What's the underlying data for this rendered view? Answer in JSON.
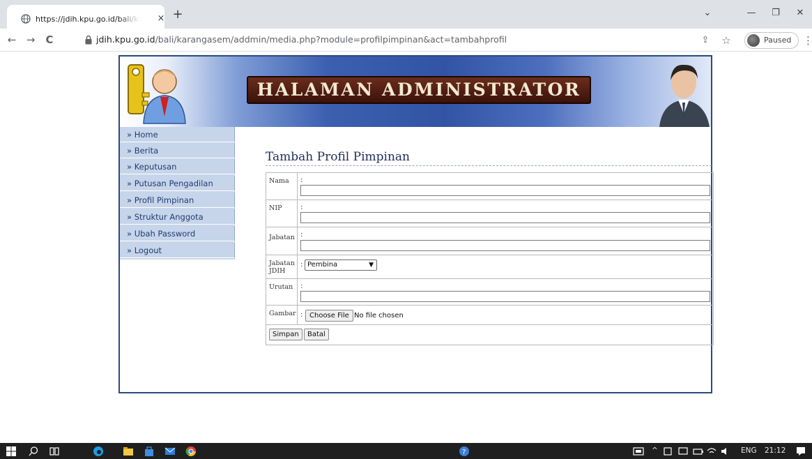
{
  "browser": {
    "tab": {
      "title": "https://jdih.kpu.go.id/bali/karangasem/addmin/media.php",
      "close_glyph": "×",
      "favicon": "globe-icon"
    },
    "new_tab_glyph": "+",
    "window_controls": {
      "tab_search": "⌄",
      "minimize": "—",
      "restore": "❐",
      "close": "✕"
    },
    "nav": {
      "back": "←",
      "forward": "→",
      "reload": "C"
    },
    "address": {
      "host": "jdih.kpu.go.id",
      "path": "/bali/karangasem/addmin/media.php?module=profilpimpinan&act=tambahprofil"
    },
    "share_glyph": "⇪",
    "star_glyph": "☆",
    "profile_label": "Paused",
    "menu_glyph": "⋮"
  },
  "banner": {
    "title": "HALAMAN ADMINISTRATOR"
  },
  "sidebar": {
    "items": [
      {
        "label": "» Home"
      },
      {
        "label": "» Berita"
      },
      {
        "label": "» Keputusan"
      },
      {
        "label": "» Putusan Pengadilan"
      },
      {
        "label": "» Profil Pimpinan"
      },
      {
        "label": "» Struktur Anggota"
      },
      {
        "label": "» Ubah Password"
      },
      {
        "label": "» Logout"
      }
    ]
  },
  "content": {
    "title": "Tambah Profil Pimpinan",
    "form": {
      "colon": ":",
      "nama_label": "Nama",
      "nip_label": "NIP",
      "jabatan_label": "Jabatan",
      "jabatan_jdih_label": "Jabatan JDIH",
      "jabatan_jdih_selected": "Pembina",
      "urutan_label": "Urutan",
      "gambar_label": "Gambar",
      "choose_file_label": "Choose File",
      "file_status": "No file chosen",
      "simpan_label": "Simpan",
      "batal_label": "Batal"
    }
  },
  "taskbar": {
    "lang": "ENG",
    "time": "21:12"
  },
  "colors": {
    "frame": "#2b4a7e",
    "sidebar": "#c7d5ea",
    "link": "#1f3d73"
  }
}
